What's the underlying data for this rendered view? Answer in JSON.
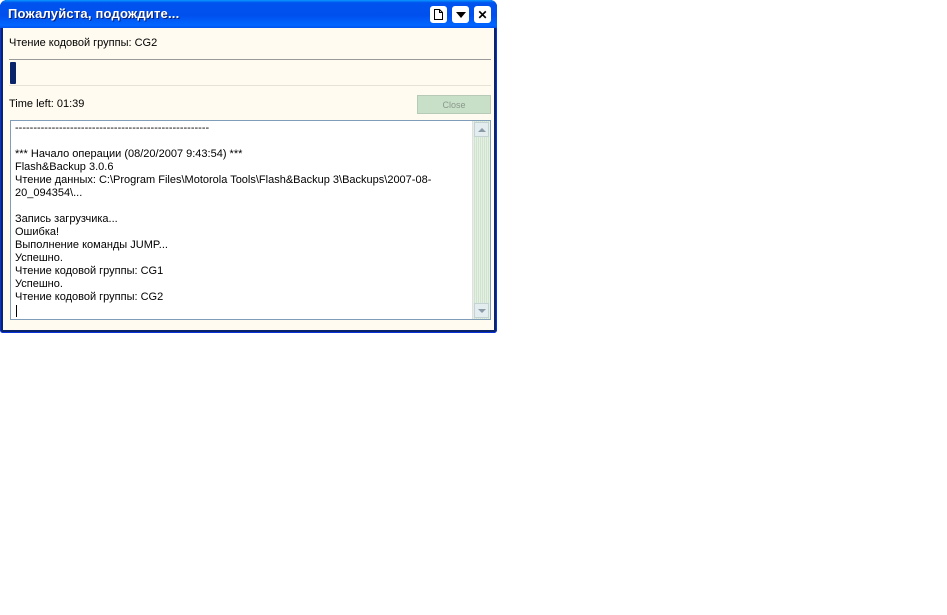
{
  "window": {
    "title": "Пожалуйста, подождите...",
    "buttons": {
      "copy_icon": "page-icon",
      "minimize_icon": "dropdown-icon",
      "close_icon": "close-icon",
      "close_glyph": "✕"
    }
  },
  "status": {
    "label": "Чтение кодовой группы: CG2"
  },
  "progress": {
    "percent": 1.2,
    "color": "#0a246a"
  },
  "time_left": {
    "label": "Time left: 01:39"
  },
  "close_button": {
    "label": "Close",
    "enabled": false
  },
  "log": {
    "lines": [
      "-----------------------------------------------------",
      "",
      "*** Начало операции (08/20/2007 9:43:54) ***",
      "Flash&Backup 3.0.6",
      "Чтение данных: C:\\Program Files\\Motorola Tools\\Flash&Backup 3\\Backups\\2007-08-20_094354\\...",
      "",
      "Запись загрузчика...",
      "Ошибка!",
      "Выполнение команды JUMP...",
      "Успешно.",
      "Чтение кодовой группы: CG1",
      "Успешно.",
      "Чтение кодовой группы: CG2"
    ]
  },
  "colors": {
    "titlebar": "#0053ee",
    "client_bg": "#fffbf0",
    "close_button_bg": "#c8e0c8"
  }
}
